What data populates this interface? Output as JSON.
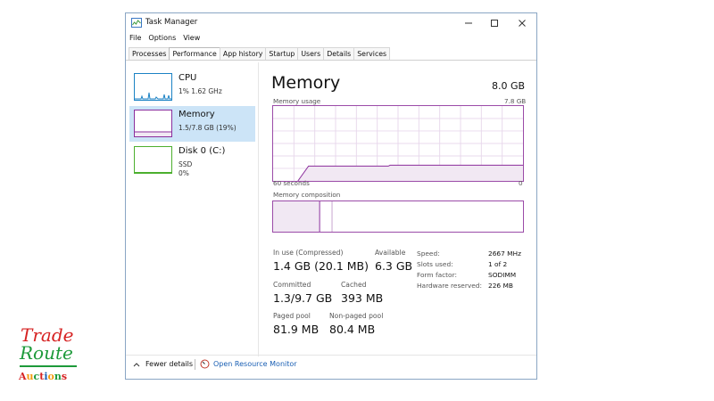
{
  "window": {
    "title": "Task Manager",
    "controls": {
      "minimize": "minimize-icon",
      "maximize": "maximize-icon",
      "close": "close-icon"
    }
  },
  "menu": {
    "file": "File",
    "options": "Options",
    "view": "View"
  },
  "tabs": [
    "Processes",
    "Performance",
    "App history",
    "Startup",
    "Users",
    "Details",
    "Services"
  ],
  "active_tab": "Performance",
  "resources": [
    {
      "name": "CPU",
      "detail": "1% 1.62 GHz",
      "color": "#1b82c4"
    },
    {
      "name": "Memory",
      "detail": "1.5/7.8 GB (19%)",
      "color": "#8b2e9c"
    },
    {
      "name": "Disk 0 (C:)",
      "detail": "SSD",
      "detail2": "0%",
      "color": "#4caf2e"
    }
  ],
  "memory": {
    "title": "Memory",
    "total": "8.0 GB",
    "usage_label": "Memory usage",
    "usage_max": "7.8 GB",
    "time_label": "60 seconds",
    "time_end": "0",
    "composition_label": "Memory composition",
    "usage_fraction": 0.19,
    "stats": {
      "in_use_label": "In use (Compressed)",
      "in_use_value": "1.4 GB (20.1 MB)",
      "available_label": "Available",
      "available_value": "6.3 GB",
      "committed_label": "Committed",
      "committed_value": "1.3/9.7 GB",
      "cached_label": "Cached",
      "cached_value": "393 MB",
      "paged_label": "Paged pool",
      "paged_value": "81.9 MB",
      "nonpaged_label": "Non-paged pool",
      "nonpaged_value": "80.4 MB"
    },
    "hardware": {
      "speed_label": "Speed:",
      "speed_value": "2667 MHz",
      "slots_label": "Slots used:",
      "slots_value": "1 of 2",
      "form_label": "Form factor:",
      "form_value": "SODIMM",
      "reserved_label": "Hardware reserved:",
      "reserved_value": "226 MB"
    }
  },
  "footer": {
    "fewer_details": "Fewer details",
    "open_monitor": "Open Resource Monitor"
  },
  "watermark": {
    "line1": "Trade",
    "line2": "Route",
    "line3": "Auctions"
  },
  "colors": {
    "memory_accent": "#8b2e9c",
    "memory_fill": "#f1e8f3",
    "selection": "#cce4f7",
    "link": "#1a5fb4"
  }
}
